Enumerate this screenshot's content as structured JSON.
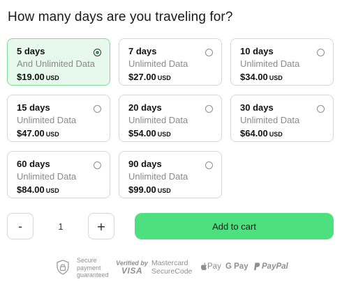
{
  "title": "How many days are you traveling for?",
  "plans": [
    {
      "days": "5 days",
      "data": "And Unlimited Data",
      "price": "$19.00",
      "currency": "USD",
      "selected": true
    },
    {
      "days": "7 days",
      "data": "Unlimited Data",
      "price": "$27.00",
      "currency": "USD",
      "selected": false
    },
    {
      "days": "10 days",
      "data": "Unlimited Data",
      "price": "$34.00",
      "currency": "USD",
      "selected": false
    },
    {
      "days": "15 days",
      "data": "Unlimited Data",
      "price": "$47.00",
      "currency": "USD",
      "selected": false
    },
    {
      "days": "20 days",
      "data": "Unlimited Data",
      "price": "$54.00",
      "currency": "USD",
      "selected": false
    },
    {
      "days": "30 days",
      "data": "Unlimited Data",
      "price": "$64.00",
      "currency": "USD",
      "selected": false
    },
    {
      "days": "60 days",
      "data": "Unlimited Data",
      "price": "$84.00",
      "currency": "USD",
      "selected": false
    },
    {
      "days": "90 days",
      "data": "Unlimited Data",
      "price": "$99.00",
      "currency": "USD",
      "selected": false
    }
  ],
  "quantity": {
    "minus_label": "-",
    "value": "1",
    "plus_label": "+"
  },
  "add_to_cart_label": "Add to cart",
  "payments": {
    "secure_line1": "Secure",
    "secure_line2": "payment",
    "secure_line3": "guaranteed",
    "visa_line1": "Verified by",
    "visa_line2": "VISA",
    "mastercard_line1": "Mastercard",
    "mastercard_line2": "SecureCode",
    "apple_pay": "Pay",
    "google_pay": "G Pay",
    "paypal": "PayPal"
  },
  "colors": {
    "accent": "#4ee07f",
    "selected_bg": "#e6f9ec",
    "selected_dot": "#1ea54a"
  }
}
